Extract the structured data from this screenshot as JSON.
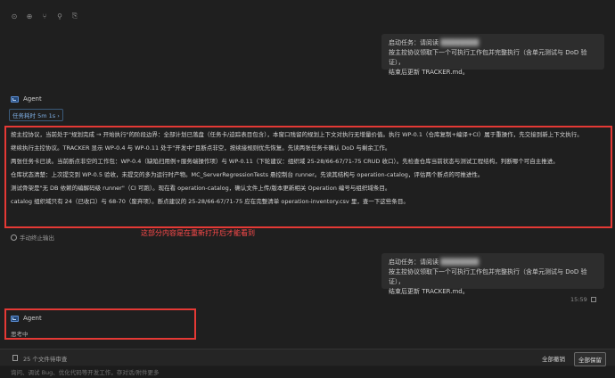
{
  "toolbar": {
    "icons": [
      "undo-icon",
      "redo-icon",
      "fork-icon",
      "pin-icon",
      "copy-icon"
    ]
  },
  "messages": {
    "user1": {
      "line1_prefix": "启动任务：请阅读",
      "line1_blur": "████████",
      "line2": "按主控协议领取下一个可执行工作包并完整执行（含单元测试与 DoD 验证），",
      "line3": "结束后更新 TRACKER.md。"
    },
    "agent1": {
      "name": "Agent",
      "task_time": "任务耗时 5m 1s",
      "paragraphs": [
        "按主控协议，当前处于\"规划完成 → 开始执行\"的阶段边界：全部计划已落盘（任务卡/迫踪表目包含），本窗口残留的规划上下文对执行无增量价值。执行 WP-0.1（仓库复制+编译+CI）属于重操作，先交接到新上下文执行。",
        "继续执行主控协议。TRACKER 显示 WP-0.4 与 WP-0.11 处于\"开发中\"且断点非空，按续接规则优先恢复。先读两张任务卡确认 DoD 与剩余工作。",
        "两张任务卡已读。当前断点非空的工作包：WP-0.4（缺陷扫用例+服务端操作项）与 WP-0.11（下轮建议：组织域 25-28/66-67/71-75 CRUD 收口）。先检查仓库当前状态与测试工程结构，判断哪个可自主推进。",
        "仓库状态清楚：上次提交到 WP-0.5 验收，未提交的多为运行时产物。MC_ServerRegressionTests 悬控制台 runner。先读其结构与 operation-catalog，评估两个断点的可推进性。",
        "测试骨架是\"无 DB 依赖的编解码级 runner\"（CI 可跑）。现在看 operation-catalog，确认文件上传/版本更新相关 Operation 编号与组织域条目。",
        "catalog 组织域只有 24（已收口）与 68-70（废弃项）。断点建议的 25-28/66-67/71-75 应在完整清单 operation-inventory.csv 里，查一下这些条目。"
      ]
    },
    "annotation": "这部分内容是在重新打开后才能看到",
    "stop_output": "手动终止输出",
    "user2": {
      "line1_prefix": "启动任务：请阅读",
      "line1_blur": "████████",
      "line2": "按主控协议领取下一个可执行工作包并完整执行（含单元测试与 DoD 验证），",
      "line3": "结束后更新 TRACKER.md。",
      "time": "15:59"
    },
    "agent2": {
      "name": "Agent",
      "status": "思考中"
    }
  },
  "bottom_bar": {
    "files_count": "25 个文件待审查",
    "undo_all": "全部撤销",
    "keep_all": "全部保留"
  },
  "input": {
    "placeholder": "询问、调试 Bug、优化代码等开发工作，存对话/附件更多"
  }
}
